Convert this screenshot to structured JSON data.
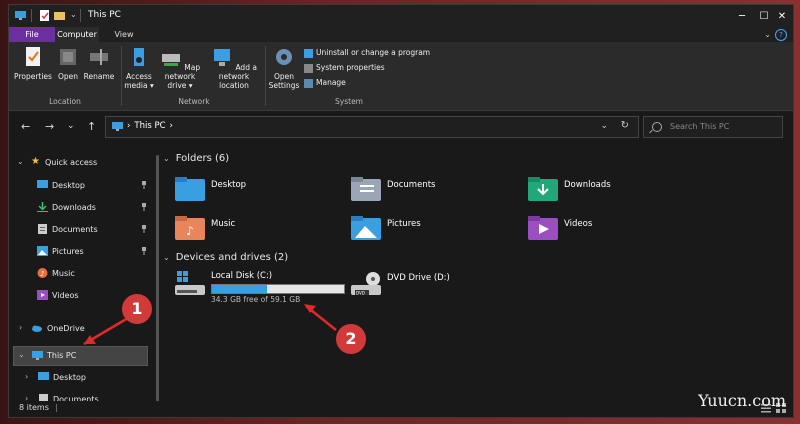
{
  "window": {
    "title": "This PC"
  },
  "ribbon_tabs": [
    {
      "label": "File"
    },
    {
      "label": "Computer"
    },
    {
      "label": "View"
    }
  ],
  "ribbon": {
    "location": {
      "label": "Location",
      "buttons": [
        {
          "label": "Properties"
        },
        {
          "label": "Open"
        },
        {
          "label": "Rename"
        }
      ]
    },
    "network": {
      "label": "Network",
      "buttons": [
        {
          "label": "Access media ▾"
        },
        {
          "label": "Map network drive ▾"
        },
        {
          "label": "Add a network location"
        }
      ]
    },
    "system": {
      "label": "System",
      "open_settings": "Open Settings",
      "items": [
        {
          "label": "Uninstall or change a program"
        },
        {
          "label": "System properties"
        },
        {
          "label": "Manage"
        }
      ]
    }
  },
  "address": {
    "path": "This PC",
    "search_placeholder": "Search This PC"
  },
  "sidebar": {
    "quick_access": "Quick access",
    "items": [
      {
        "label": "Desktop"
      },
      {
        "label": "Downloads"
      },
      {
        "label": "Documents"
      },
      {
        "label": "Pictures"
      },
      {
        "label": "Music"
      },
      {
        "label": "Videos"
      }
    ],
    "onedrive": "OneDrive",
    "this_pc": "This PC",
    "sub_items": [
      {
        "label": "Desktop"
      },
      {
        "label": "Documents"
      }
    ]
  },
  "main": {
    "folders_header": "Folders (6)",
    "folders": [
      {
        "label": "Desktop"
      },
      {
        "label": "Documents"
      },
      {
        "label": "Downloads"
      },
      {
        "label": "Music"
      },
      {
        "label": "Pictures"
      },
      {
        "label": "Videos"
      }
    ],
    "devices_header": "Devices and drives (2)",
    "drives": [
      {
        "label": "Local Disk (C:)",
        "free_text": "34.3 GB free of 59.1 GB",
        "used_fraction": 0.42
      },
      {
        "label": "DVD Drive (D:)"
      }
    ]
  },
  "status": {
    "items": "8 items"
  },
  "annotations": [
    {
      "label": "1"
    },
    {
      "label": "2"
    }
  ],
  "watermark": "Yuucn.com",
  "colors": {
    "accent": "#3a9fe0",
    "file_tab": "#6b2fa0",
    "callout": "#d23a3a"
  }
}
